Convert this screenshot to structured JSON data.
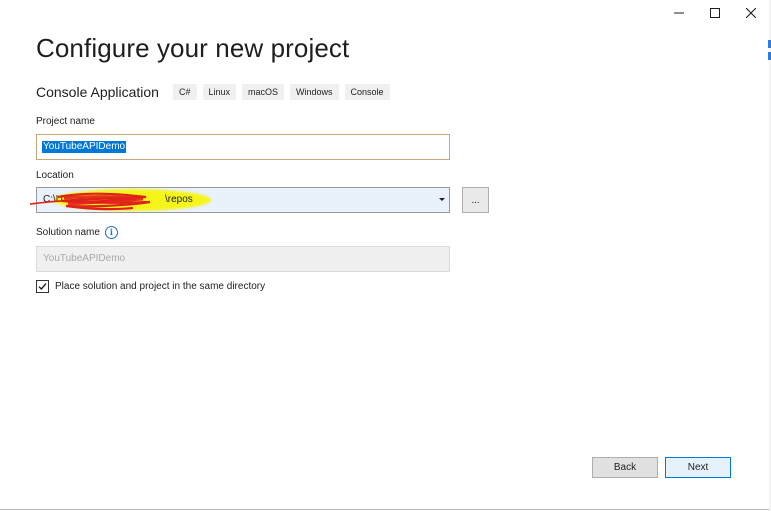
{
  "window": {
    "controls": {
      "minimize_icon": "minimize-icon",
      "maximize_icon": "maximize-icon",
      "close_icon": "close-icon"
    }
  },
  "page": {
    "title": "Configure your new project"
  },
  "template": {
    "name": "Console Application",
    "tags": [
      "C#",
      "Linux",
      "macOS",
      "Windows",
      "Console"
    ]
  },
  "project_name": {
    "label": "Project name",
    "value": "YouTubeAPIDemo"
  },
  "location": {
    "label": "Location",
    "value_visible_suffix": "C:\\U",
    "value_visible_end": "\\repos",
    "browse_label": "..."
  },
  "solution_name": {
    "label": "Solution name",
    "info_icon": "info-icon",
    "value": "YouTubeAPIDemo"
  },
  "same_directory": {
    "label": "Place solution and project in the same directory",
    "checked": true
  },
  "footer": {
    "back_label": "Back",
    "next_label": "Next"
  },
  "colors": {
    "selection": "#0078d7",
    "highlight_markup": "#f5f51a",
    "redaction_scribble": "#e0201a",
    "info_accent": "#1f6fd1"
  }
}
